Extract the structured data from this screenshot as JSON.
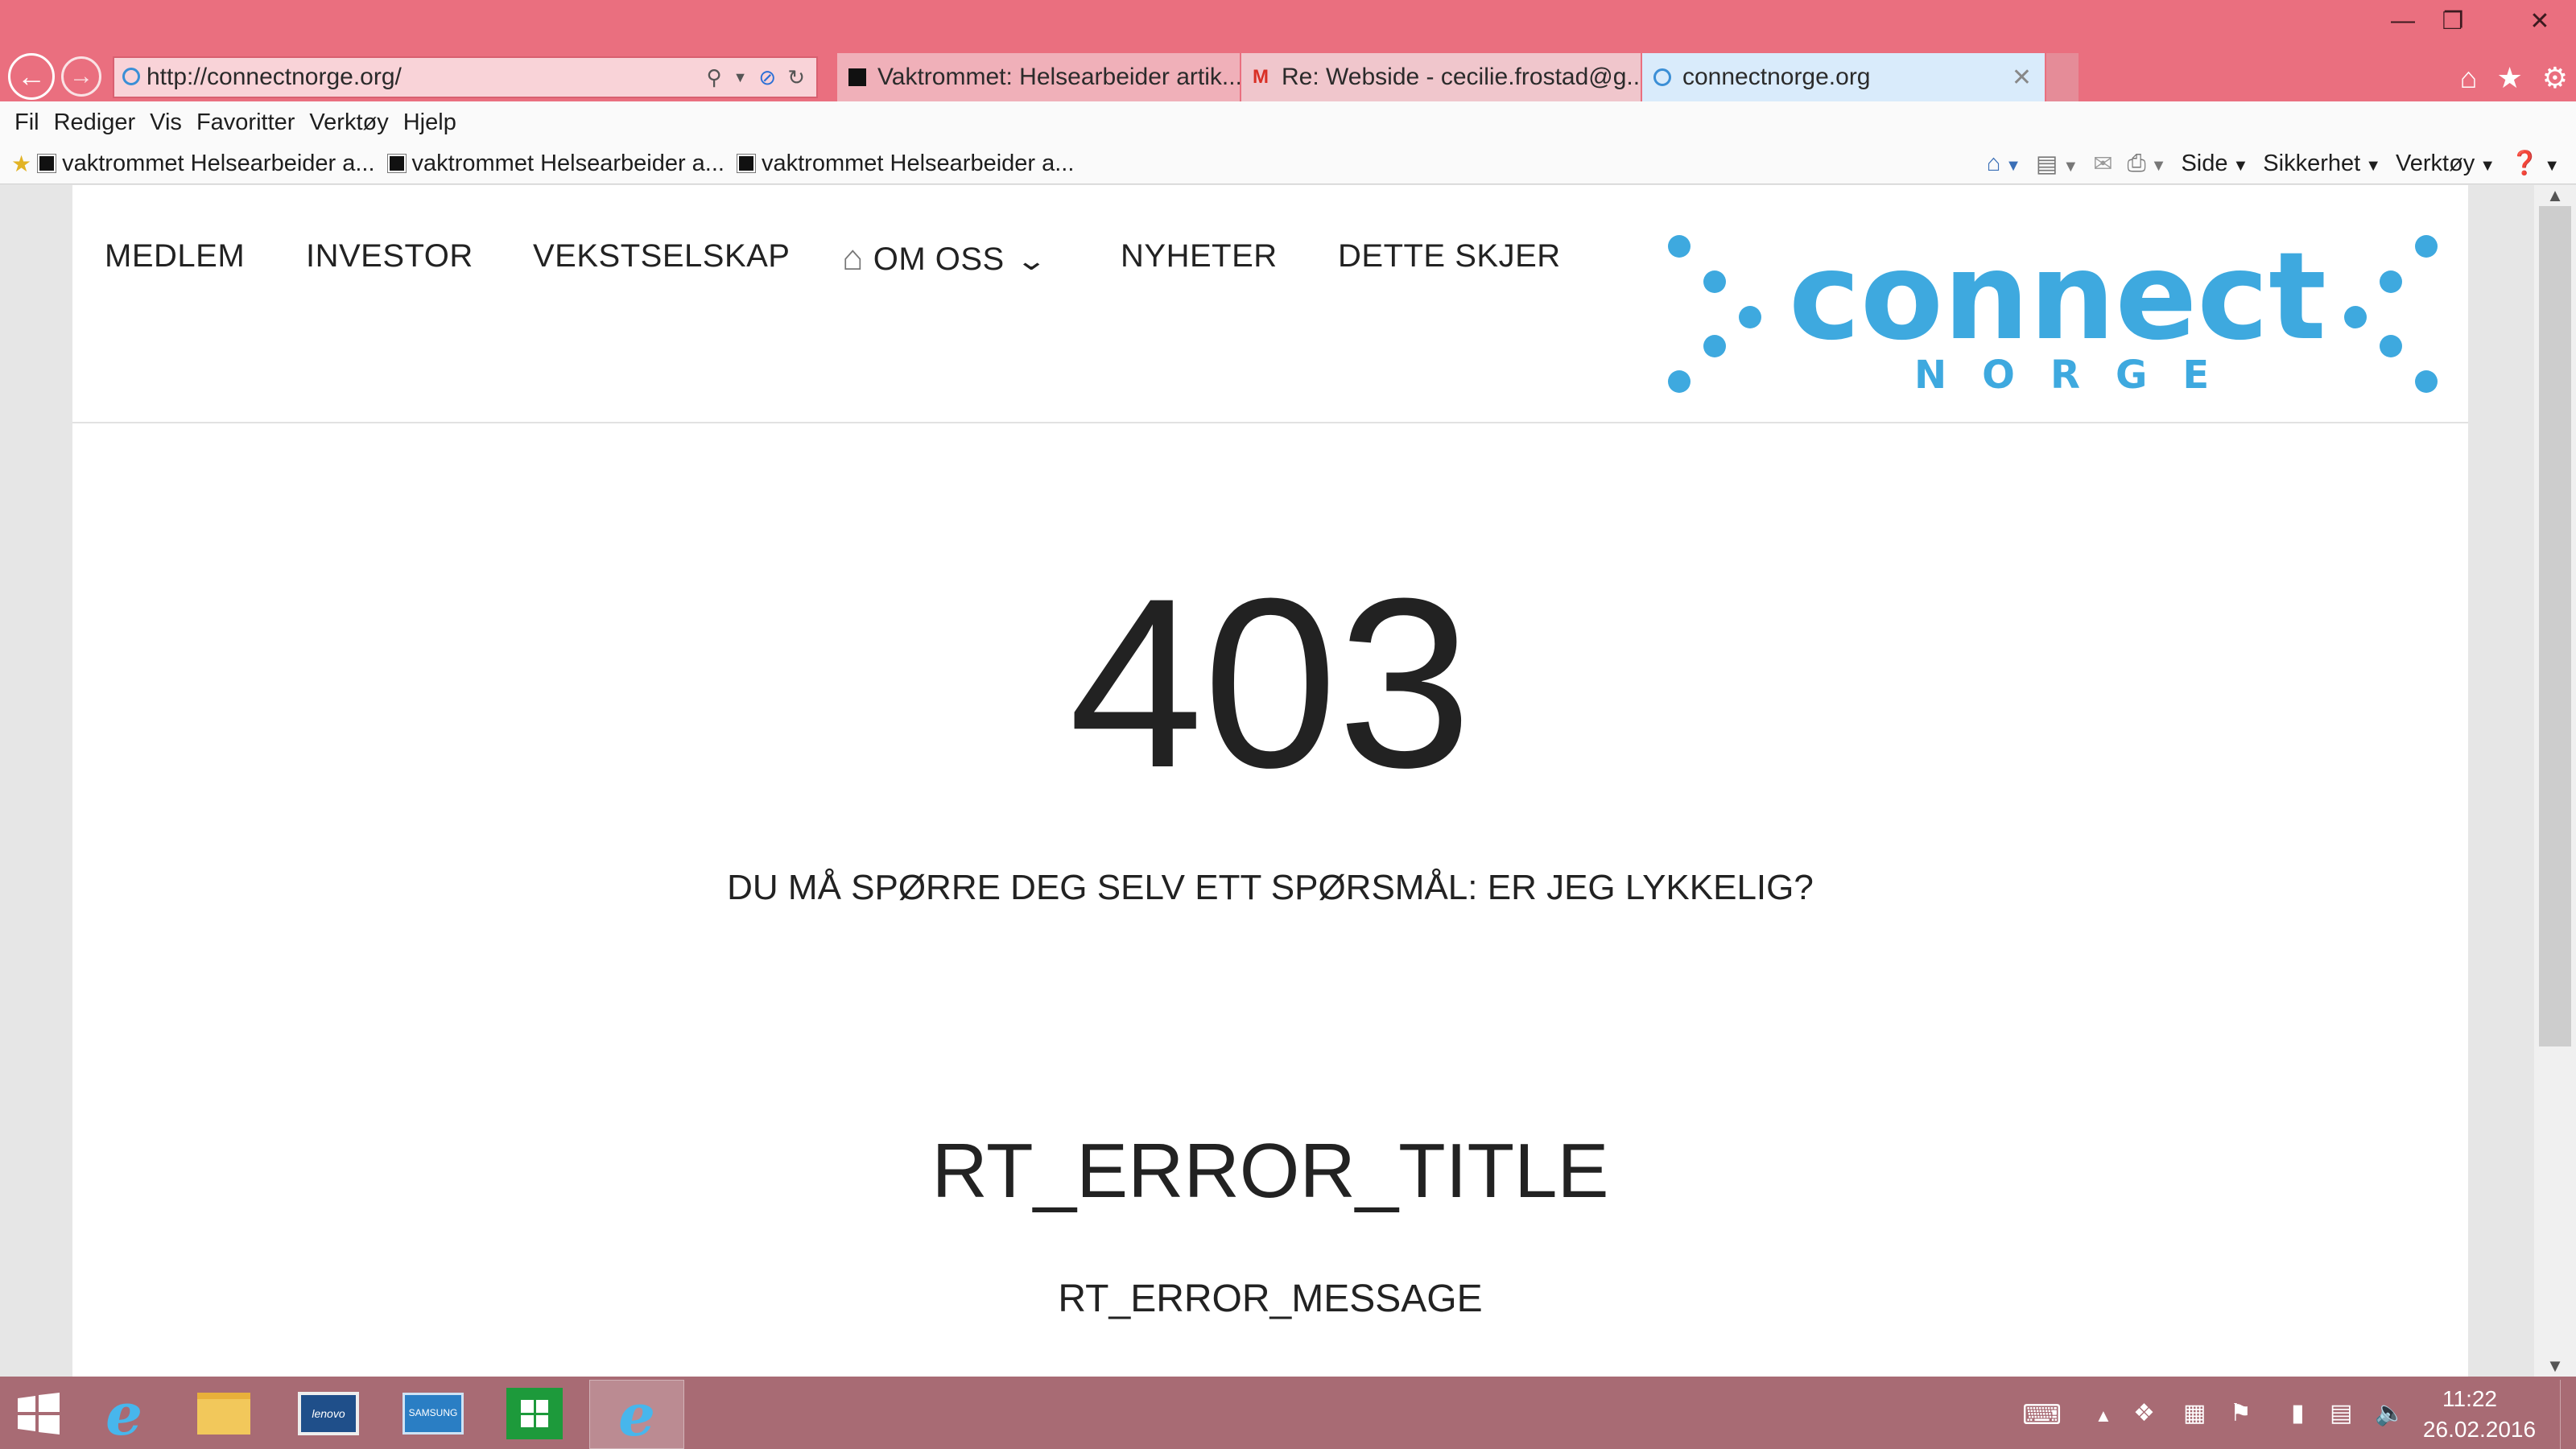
{
  "browser": {
    "address": {
      "url": "http://connectnorge.org/"
    },
    "tabs": [
      {
        "label": "Vaktrommet: Helsearbeider artik..."
      },
      {
        "label": "Re: Webside - cecilie.frostad@g..."
      },
      {
        "label": "connectnorge.org"
      }
    ],
    "menu": [
      "Fil",
      "Rediger",
      "Vis",
      "Favoritter",
      "Verktøy",
      "Hjelp"
    ],
    "favorites": [
      {
        "label": "vaktrommet Helsearbeider a..."
      },
      {
        "label": "vaktrommet Helsearbeider a..."
      },
      {
        "label": "vaktrommet Helsearbeider a..."
      }
    ],
    "command_bar": {
      "page": "Side",
      "safety": "Sikkerhet",
      "tools": "Verktøy"
    },
    "icons": {
      "back": "back-arrow-icon",
      "forward": "forward-arrow-icon",
      "home": "home-icon",
      "favorites": "star-icon",
      "settings": "gear-icon"
    }
  },
  "site": {
    "nav": {
      "medlem": "MEDLEM",
      "investor": "INVESTOR",
      "vekstselskap": "VEKSTSELSKAP",
      "om_oss": "OM OSS",
      "nyheter": "NYHETER",
      "dette_skjer": "DETTE SKJER"
    },
    "logo": {
      "word": "connect",
      "sub": "NORGE",
      "color": "#3ea9df"
    }
  },
  "error": {
    "code": "403",
    "subtitle": "DU MÅ SPØRRE DEG SELV ETT SPØRSMÅL: ER JEG LYKKELIG?",
    "title": "RT_ERROR_TITLE",
    "message": "RT_ERROR_MESSAGE"
  },
  "taskbar": {
    "time": "11:22",
    "date": "26.02.2016",
    "colors": {
      "taskbar": "#a86b74",
      "chrome": "#ea6f7f"
    }
  }
}
